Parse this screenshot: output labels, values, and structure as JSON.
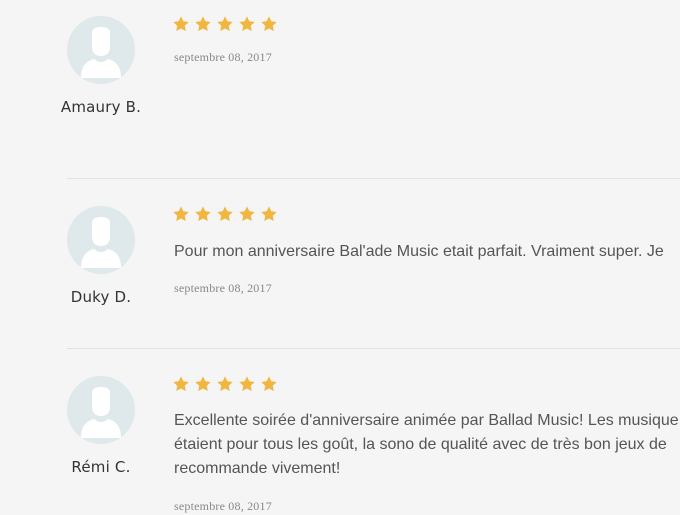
{
  "colors": {
    "background": "#f5f5f5",
    "star": "#f0b63f",
    "avatar_bg": "#dfe9ec",
    "avatar_fg": "#ffffff",
    "divider": "#e2e2e2"
  },
  "reviews": [
    {
      "author": "Amaury B.",
      "rating": 5,
      "text_lines": [],
      "date": "septembre 08, 2017"
    },
    {
      "author": "Duky D.",
      "rating": 5,
      "text_lines": [
        "Pour mon anniversaire Bal'ade Music etait parfait. Vraiment super. Je"
      ],
      "date": "septembre 08, 2017"
    },
    {
      "author": "Rémi C.",
      "rating": 5,
      "text_lines": [
        "Excellente soirée d'anniversaire animée par Ballad Music! Les musique",
        "étaient pour tous les goût, la sono de qualité avec de très bon jeux de",
        "recommande vivement!"
      ],
      "date": "septembre 08, 2017"
    }
  ]
}
